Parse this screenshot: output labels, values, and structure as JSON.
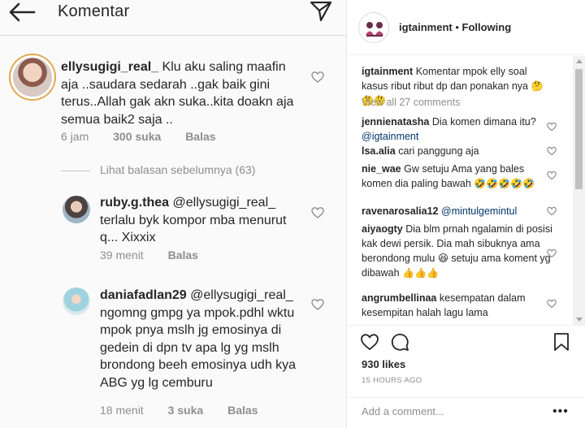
{
  "left": {
    "header": {
      "title": "Komentar"
    },
    "main_comment": {
      "username": "ellysugigi_real_",
      "text": "Klu aku saling maafin aja ..saudara sedarah ..gak baik gini terus..Allah gak akn suka..kita doakn aja semua baik2 saja ..",
      "time": "6 jam",
      "likes": "300 suka",
      "reply": "Balas"
    },
    "view_replies": "Lihat balasan sebelumnya (63)",
    "replies": [
      {
        "username": "ruby.g.thea",
        "mention": "@ellysugigi_real_",
        "text": "terlalu byk kompor mba menurut q... Xixxix",
        "time": "39 menit",
        "reply": "Balas"
      },
      {
        "username": "daniafadlan29",
        "mention": "@ellysugigi_real_",
        "text": "ngomng gmpg ya mpok.pdhl wktu mpok pnya mslh jg emosinya di gedein di dpn tv apa lg yg mslh brondong beeh emosinya udh kya ABG yg lg cemburu",
        "time": "18 menit",
        "likes": "3 suka",
        "reply": "Balas"
      }
    ]
  },
  "right": {
    "header": {
      "username": "igtainment",
      "separator": " • ",
      "follow_status": "Following"
    },
    "caption": {
      "username": "igtainment",
      "text": "Komentar mpok elly soal kasus ribut ribut dp dan ponakan nya",
      "emoji": "🤔🤔🤔"
    },
    "view_all": "View all 27 comments",
    "comments": [
      {
        "username": "jennienatasha",
        "text": "Dia komen dimana itu?",
        "mention": "@igtainment",
        "emoji": ""
      },
      {
        "username": "lsa.alia",
        "text": "cari panggung aja",
        "mention": "",
        "emoji": ""
      },
      {
        "username": "nie_wae",
        "text": "Gw setuju Ama yang bales komen dia paling bawah",
        "mention": "",
        "emoji": "🤣🤣🤣🤣🤣"
      },
      {
        "username": "ravenarosalia12",
        "text": "",
        "mention": "@mintulgemintul",
        "emoji": ""
      },
      {
        "username": "aiyaogty",
        "text": "Dia blm prnah ngalamin di posisi kak dewi persik. Dia mah sibuknya ama berondong mulu 😆 setuju ama koment yg dibawah",
        "mention": "",
        "emoji": "👍👍👍"
      },
      {
        "username": "angrumbellinaa",
        "text": "kesempatan dalam kesempitan halah lagu lama",
        "mention": "",
        "emoji": ""
      }
    ],
    "likes": "930 likes",
    "time_ago": "15 HOURS AGO",
    "add_comment_placeholder": "Add a comment...",
    "more_label": "•••"
  }
}
